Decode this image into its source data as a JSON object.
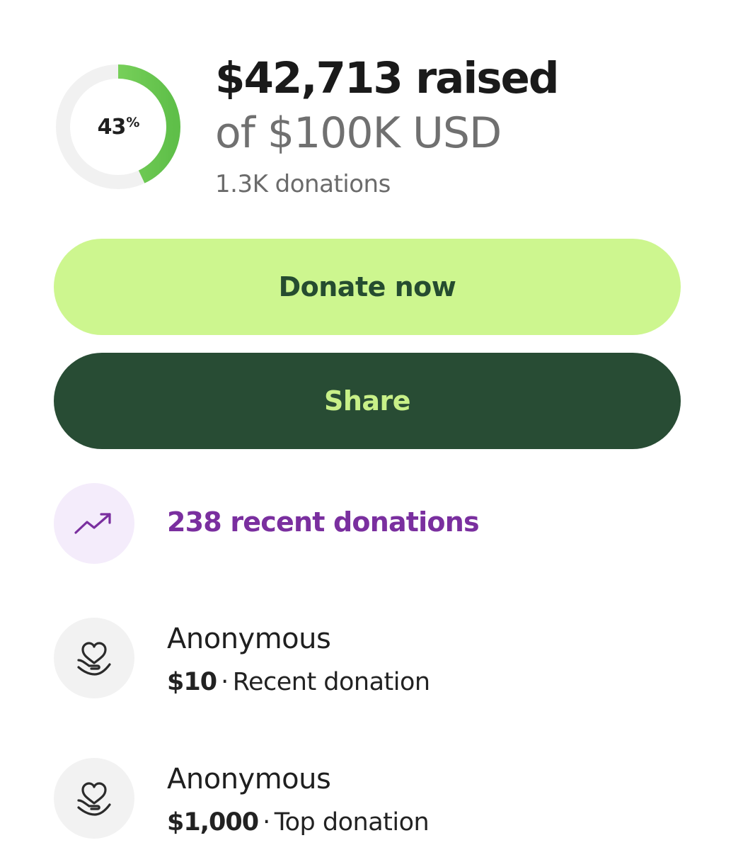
{
  "progress": {
    "percent_value": 43,
    "percent_text": "43",
    "percent_symbol": "%",
    "track_color": "#f1f1f1",
    "fill_color": "#7fd35a"
  },
  "summary": {
    "raised": "$42,713 raised",
    "goal": "of $100K USD",
    "donations_count": "1.3K donations"
  },
  "actions": {
    "donate_label": "Donate now",
    "share_label": "Share"
  },
  "recent": {
    "icon": "trending-up-icon",
    "label": "238 recent donations"
  },
  "donations": [
    {
      "icon": "heart-hand-icon",
      "name": "Anonymous",
      "amount": "$10",
      "separator": "·",
      "type": "Recent donation"
    },
    {
      "icon": "heart-hand-icon",
      "name": "Anonymous",
      "amount": "$1,000",
      "separator": "·",
      "type": "Top donation"
    }
  ],
  "colors": {
    "donate_bg": "#cdf68f",
    "share_bg": "#284c34",
    "recent_text": "#7a2f9f"
  }
}
